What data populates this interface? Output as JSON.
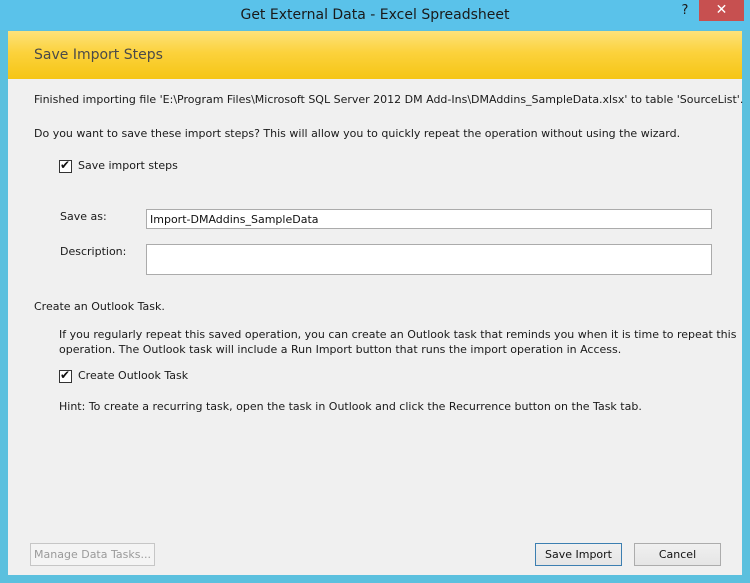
{
  "window": {
    "title": "Get External Data - Excel Spreadsheet",
    "help_label": "?",
    "close_label": "✕"
  },
  "banner": {
    "title": "Save Import Steps"
  },
  "content": {
    "finished_text": "Finished importing file 'E:\\Program Files\\Microsoft SQL Server 2012 DM Add-Ins\\DMAddins_SampleData.xlsx' to table 'SourceList'.",
    "question_text": "Do you want to save these import steps? This will allow you to quickly repeat the operation without using the wizard.",
    "save_steps_checkbox": {
      "label": "Save import steps",
      "checked": true
    },
    "save_as_label": "Save as:",
    "save_as_value": "Import-DMAddins_SampleData",
    "description_label": "Description:",
    "description_value": ""
  },
  "outlook": {
    "section_label": "Create an Outlook Task.",
    "info_line1": "If you regularly repeat this saved operation, you can create an Outlook task that reminds you when it is time to repeat this",
    "info_line2": "operation. The Outlook task will include a Run Import button that runs the import operation in Access.",
    "create_task_checkbox": {
      "label": "Create Outlook Task",
      "checked": true
    },
    "hint": "Hint: To create a recurring task, open the task in Outlook and click the Recurrence button on the Task tab."
  },
  "footer": {
    "manage_label": "Manage Data Tasks...",
    "save_import_label": "Save Import",
    "cancel_label": "Cancel"
  },
  "check_glyph": "✔"
}
